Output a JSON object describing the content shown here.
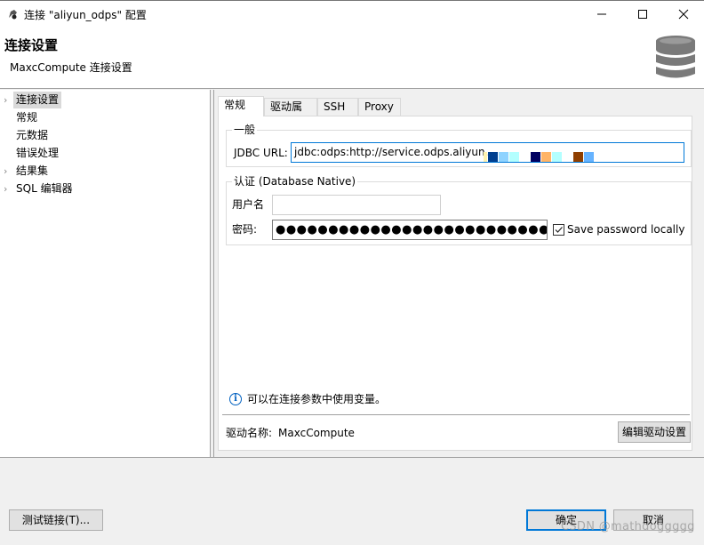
{
  "window": {
    "title": "连接 \"aliyun_odps\" 配置",
    "controls": {
      "minimize": "minimize-icon",
      "maximize": "maximize-icon",
      "close": "close-icon"
    }
  },
  "header": {
    "title": "连接设置",
    "subtitle": "MaxcCompute 连接设置",
    "icon": "database-icon"
  },
  "sidebar": {
    "items": [
      {
        "label": "连接设置",
        "expandable": true,
        "selected": true
      },
      {
        "label": "常规",
        "expandable": false
      },
      {
        "label": "元数据",
        "expandable": false
      },
      {
        "label": "错误处理",
        "expandable": false
      },
      {
        "label": "结果集",
        "expandable": true
      },
      {
        "label": "SQL 编辑器",
        "expandable": true
      }
    ]
  },
  "tabs": [
    {
      "label": "常规",
      "active": true
    },
    {
      "label": "驱动属性"
    },
    {
      "label": "SSH"
    },
    {
      "label": "Proxy"
    }
  ],
  "general": {
    "group_label": "一般",
    "jdbc_label": "JDBC URL:",
    "jdbc_value": "jdbc:odps:http://service.odps.aliyun."
  },
  "auth": {
    "group_label": "认证 (Database Native)",
    "username_label": "用户名",
    "password_label": "密码:",
    "password_value": "●●●●●●●●●●●●●●●●●●●●●●●●●●●●●●●",
    "save_password_label": "Save password locally",
    "save_password_checked": true
  },
  "hint": {
    "icon": "info-icon",
    "text": "可以在连接参数中使用变量。"
  },
  "driver": {
    "label": "驱动名称:",
    "value": "MaxcCompute",
    "edit_button": "编辑驱动设置"
  },
  "footer": {
    "test_button": "测试链接(T)...",
    "ok_button": "确定",
    "cancel_button": "取消"
  },
  "watermark": "CSDN @mathdoggggg",
  "colors": {
    "accent": "#0078d7",
    "selection": "#d9d9d9"
  }
}
